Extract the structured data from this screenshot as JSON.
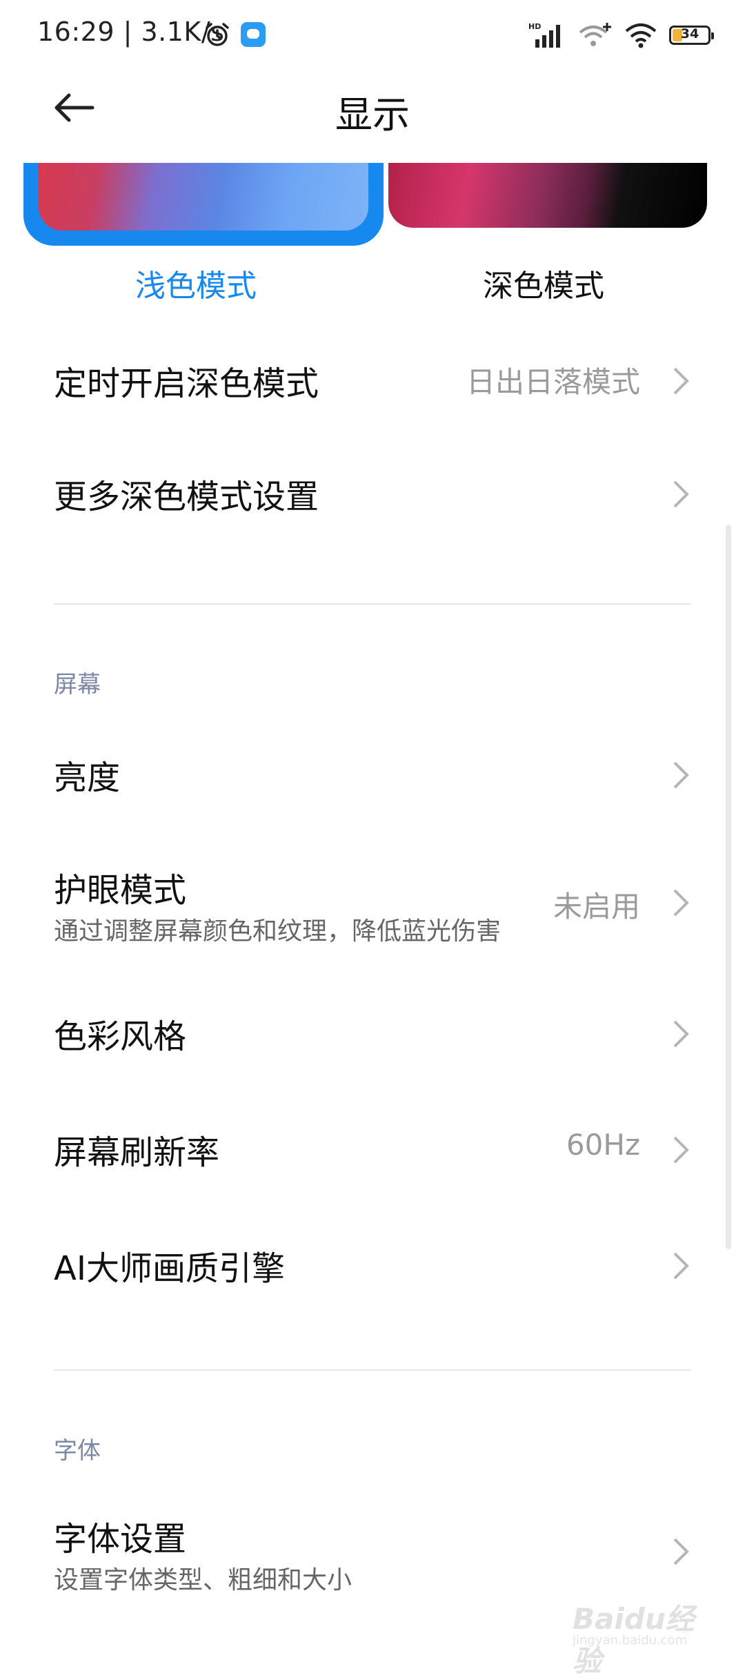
{
  "status_bar": {
    "time": "16:29",
    "speed": "3.1K/s",
    "battery": "34",
    "battery_color": "#f3b23a",
    "icons": [
      "alarm-icon",
      "chat-app-icon",
      "hd-signal-icon",
      "wifi-plus-icon",
      "wifi-icon",
      "battery-icon"
    ]
  },
  "header": {
    "title": "显示",
    "back_icon": "arrow-left-icon"
  },
  "theme": {
    "light_label": "浅色模式",
    "dark_label": "深色模式",
    "selected": "light",
    "accent": "#1688ee"
  },
  "dark_settings": [
    {
      "title": "定时开启深色模式",
      "value": "日出日落模式"
    },
    {
      "title": "更多深色模式设置",
      "value": ""
    }
  ],
  "screen_section": {
    "header": "屏幕",
    "items": [
      {
        "title": "亮度",
        "subtitle": "",
        "value": ""
      },
      {
        "title": "护眼模式",
        "subtitle": "通过调整屏幕颜色和纹理，降低蓝光伤害",
        "value": "未启用"
      },
      {
        "title": "色彩风格",
        "subtitle": "",
        "value": ""
      },
      {
        "title": "屏幕刷新率",
        "subtitle": "",
        "value": "60Hz"
      },
      {
        "title": "AI大师画质引擎",
        "subtitle": "",
        "value": ""
      }
    ]
  },
  "font_section": {
    "header": "字体",
    "items": [
      {
        "title": "字体设置",
        "subtitle": "设置字体类型、粗细和大小",
        "value": ""
      }
    ]
  },
  "watermark": {
    "text": "Baidu经验",
    "url": "jingyan.baidu.com"
  }
}
